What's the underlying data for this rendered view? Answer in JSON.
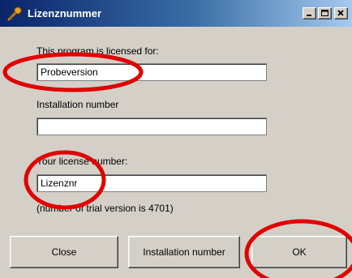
{
  "window": {
    "title": "Lizenznummer",
    "icon": "key-icon",
    "controls": [
      "minimize-icon",
      "maximize-icon",
      "close-icon"
    ]
  },
  "licensed_for": {
    "label": "This program is licensed for:",
    "value": "Probeversion"
  },
  "installation": {
    "label": "Installation number",
    "value": ""
  },
  "license": {
    "label": "Your license number:",
    "value": "Lizenznr",
    "hint": "(number of trial version is 4701)"
  },
  "buttons": {
    "close": "Close",
    "installation_number": "Installation number",
    "ok": "OK"
  },
  "annotation_color": "#e00000"
}
